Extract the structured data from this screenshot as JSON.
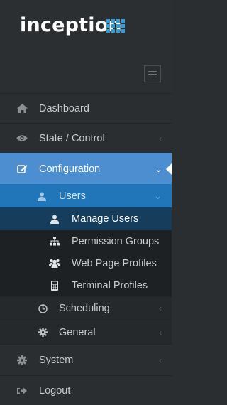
{
  "brand": {
    "name": "inception"
  },
  "menu": {
    "dashboard": "Dashboard",
    "state_control": "State / Control",
    "configuration": "Configuration",
    "users": "Users",
    "manage_users": "Manage Users",
    "permission_groups": "Permission Groups",
    "web_page_profiles": "Web Page Profiles",
    "terminal_profiles": "Terminal Profiles",
    "scheduling": "Scheduling",
    "general": "General",
    "system": "System",
    "logout": "Logout"
  },
  "colors": {
    "sidebar_bg": "#2b2e30",
    "active_section": "#4c8ed0",
    "active_subsection": "#2076b8",
    "selected_item": "#163d5b",
    "logo_accent": "#2e9ee0"
  },
  "icons": {
    "dashboard": "home-icon",
    "state_control": "eye-icon",
    "configuration": "edit-icon",
    "users": "user-icon",
    "manage_users": "user-icon",
    "permission_groups": "sitemap-icon",
    "web_page_profiles": "users-icon",
    "terminal_profiles": "keypad-icon",
    "scheduling": "clock-icon",
    "general": "cog-icon",
    "system": "cog-icon",
    "logout": "sign-out-icon"
  }
}
